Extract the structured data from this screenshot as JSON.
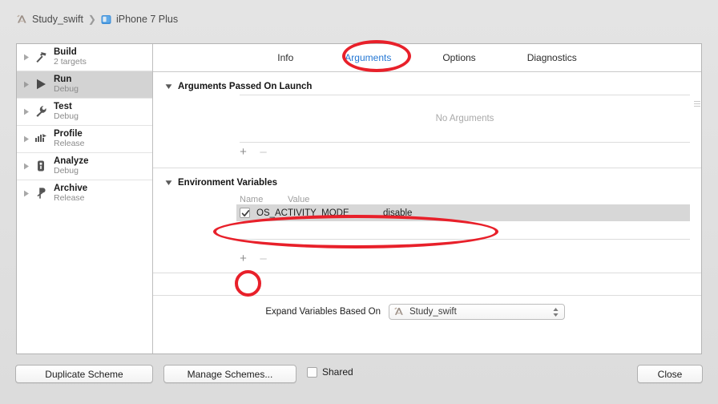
{
  "window": {
    "breadcrumb": [
      {
        "icon": "xcode-app-icon",
        "label": "Study_swift"
      },
      {
        "icon": "iphone-device-icon",
        "label": "iPhone 7 Plus"
      }
    ],
    "separator": "❯"
  },
  "sidebar": {
    "items": [
      {
        "title": "Build",
        "subtitle": "2 targets",
        "icon": "hammer-icon",
        "selected": false
      },
      {
        "title": "Run",
        "subtitle": "Debug",
        "icon": "play-icon",
        "selected": true
      },
      {
        "title": "Test",
        "subtitle": "Debug",
        "icon": "wrench-icon",
        "selected": false
      },
      {
        "title": "Profile",
        "subtitle": "Release",
        "icon": "gauge-icon",
        "selected": false
      },
      {
        "title": "Analyze",
        "subtitle": "Debug",
        "icon": "microscope-icon",
        "selected": false
      },
      {
        "title": "Archive",
        "subtitle": "Release",
        "icon": "archive-icon",
        "selected": false
      }
    ]
  },
  "tabs": [
    {
      "label": "Info",
      "active": false
    },
    {
      "label": "Arguments",
      "active": true
    },
    {
      "label": "Options",
      "active": false
    },
    {
      "label": "Diagnostics",
      "active": false
    }
  ],
  "arguments_section": {
    "title": "Arguments Passed On Launch",
    "empty_text": "No Arguments",
    "add_label": "+",
    "remove_label": "–"
  },
  "env_section": {
    "title": "Environment Variables",
    "columns": [
      "Name",
      "Value"
    ],
    "rows": [
      {
        "checked": true,
        "name": "OS_ACTIVITY_MODE",
        "value": "disable",
        "selected": true
      }
    ],
    "add_label": "+",
    "remove_label": "–"
  },
  "expand_variables": {
    "label": "Expand Variables Based On",
    "selected": "Study_swift",
    "icon": "xcode-app-icon"
  },
  "footer": {
    "duplicate_label": "Duplicate Scheme",
    "manage_label": "Manage Schemes...",
    "shared_label": "Shared",
    "shared_checked": false,
    "close_label": "Close"
  },
  "annotations": {
    "color": "#e8202a",
    "shapes": [
      {
        "name": "arguments-tab-highlight",
        "target": "Arguments"
      },
      {
        "name": "env-row-highlight",
        "target": "OS_ACTIVITY_MODE"
      },
      {
        "name": "add-env-var-highlight",
        "target": "+"
      }
    ]
  }
}
